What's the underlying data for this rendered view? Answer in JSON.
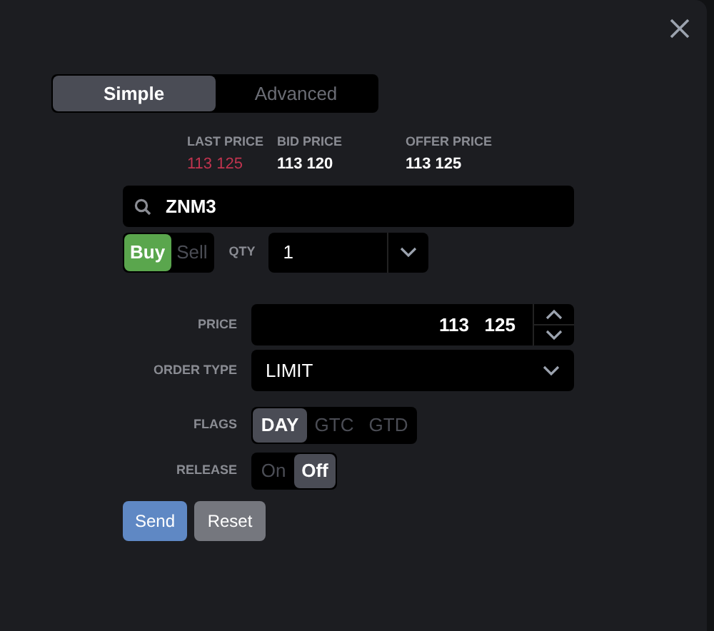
{
  "mode_tabs": [
    {
      "label": "Simple",
      "selected": true
    },
    {
      "label": "Advanced",
      "selected": false
    }
  ],
  "quotes": [
    {
      "label": "LAST PRICE",
      "value": "113 125",
      "down": true
    },
    {
      "label": "BID PRICE",
      "value": "113 120",
      "down": false
    },
    {
      "label": "OFFER PRICE",
      "value": "113 125",
      "down": false
    }
  ],
  "symbol": {
    "value": "ZNM3"
  },
  "side": [
    {
      "label": "Buy",
      "selected": true
    },
    {
      "label": "Sell",
      "selected": false
    }
  ],
  "qty": {
    "label": "QTY",
    "value": "1"
  },
  "price": {
    "label": "PRICE",
    "value": "113   125"
  },
  "order_type": {
    "label": "ORDER TYPE",
    "value": "LIMIT"
  },
  "flags": {
    "label": "FLAGS",
    "options": [
      {
        "label": "DAY",
        "selected": true
      },
      {
        "label": "GTC",
        "selected": false
      },
      {
        "label": "GTD",
        "selected": false
      }
    ]
  },
  "release": {
    "label": "RELEASE",
    "options": [
      {
        "label": "On",
        "selected": false
      },
      {
        "label": "Off",
        "selected": true
      }
    ]
  },
  "buttons": [
    {
      "label": "Send",
      "kind": "primary"
    },
    {
      "label": "Reset",
      "kind": "secondary"
    }
  ]
}
